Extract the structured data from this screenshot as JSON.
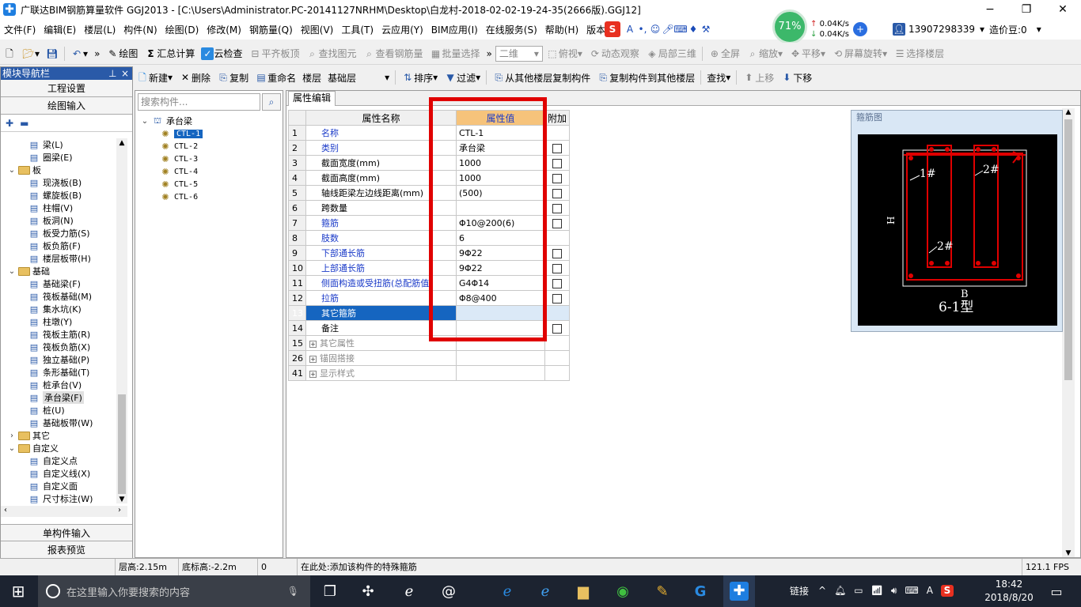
{
  "window": {
    "title": "广联达BIM钢筋算量软件 GGJ2013 - [C:\\Users\\Administrator.PC-20141127NRHM\\Desktop\\白龙村-2018-02-02-19-24-35(2666版).GGJ12]",
    "min": "−",
    "max": "❐",
    "close": "✕"
  },
  "menu": [
    "文件(F)",
    "编辑(E)",
    "楼层(L)",
    "构件(N)",
    "绘图(D)",
    "修改(M)",
    "钢筋量(Q)",
    "视图(V)",
    "工具(T)",
    "云应用(Y)",
    "BIM应用(I)",
    "在线服务(S)",
    "帮助(H)",
    "版本号"
  ],
  "net_widget": {
    "percent": "71%",
    "up": "0.04K/s",
    "down": "0.04K/s"
  },
  "user": {
    "phone": "13907298339",
    "beans": "造价豆:0"
  },
  "toolbar1": {
    "draw": "绘图",
    "sum": "汇总计算",
    "cloud_check": "云检查",
    "flat_top": "平齐板顶",
    "find_elem": "查找图元",
    "view_rebar": "查看钢筋量",
    "batch_select": "批量选择",
    "view_mode": "二维",
    "top_view": "俯视",
    "dynamic": "动态观察",
    "local3d": "局部三维",
    "fullscreen": "全屏",
    "zoom": "缩放",
    "pan": "平移",
    "rotate": "屏幕旋转",
    "select_floor": "选择楼层"
  },
  "nav": {
    "title": "模块导航栏",
    "project_settings": "工程设置",
    "drawing_input": "绘图输入",
    "single_input": "单构件输入",
    "report_preview": "报表预览",
    "tree": [
      {
        "label": "梁(L)",
        "level": 2,
        "icon": "beam-icon"
      },
      {
        "label": "圈梁(E)",
        "level": 2,
        "icon": "ring-beam-icon"
      },
      {
        "label": "板",
        "level": 1,
        "icon": "folder",
        "exp": "⌄"
      },
      {
        "label": "现浇板(B)",
        "level": 2,
        "icon": "slab-icon"
      },
      {
        "label": "螺旋板(B)",
        "level": 2,
        "icon": "spiral-slab-icon"
      },
      {
        "label": "柱帽(V)",
        "level": 2,
        "icon": "column-cap-icon"
      },
      {
        "label": "板洞(N)",
        "level": 2,
        "icon": "slab-hole-icon"
      },
      {
        "label": "板受力筋(S)",
        "level": 2,
        "icon": "slab-rebar-icon"
      },
      {
        "label": "板负筋(F)",
        "level": 2,
        "icon": "slab-neg-rebar-icon"
      },
      {
        "label": "楼层板带(H)",
        "level": 2,
        "icon": "slab-strip-icon"
      },
      {
        "label": "基础",
        "level": 1,
        "icon": "folder",
        "exp": "⌄"
      },
      {
        "label": "基础梁(F)",
        "level": 2,
        "icon": "foundation-beam-icon"
      },
      {
        "label": "筏板基础(M)",
        "level": 2,
        "icon": "raft-icon"
      },
      {
        "label": "集水坑(K)",
        "level": 2,
        "icon": "sump-icon"
      },
      {
        "label": "柱墩(Y)",
        "level": 2,
        "icon": "pier-icon"
      },
      {
        "label": "筏板主筋(R)",
        "level": 2,
        "icon": "raft-main-rebar-icon"
      },
      {
        "label": "筏板负筋(X)",
        "level": 2,
        "icon": "raft-neg-rebar-icon"
      },
      {
        "label": "独立基础(P)",
        "level": 2,
        "icon": "isolated-footing-icon"
      },
      {
        "label": "条形基础(T)",
        "level": 2,
        "icon": "strip-footing-icon"
      },
      {
        "label": "桩承台(V)",
        "level": 2,
        "icon": "pile-cap-icon"
      },
      {
        "label": "承台梁(F)",
        "level": 2,
        "icon": "cap-beam-icon",
        "selected": true
      },
      {
        "label": "桩(U)",
        "level": 2,
        "icon": "pile-icon"
      },
      {
        "label": "基础板带(W)",
        "level": 2,
        "icon": "foundation-strip-icon"
      },
      {
        "label": "其它",
        "level": 1,
        "icon": "folder",
        "exp": "›"
      },
      {
        "label": "自定义",
        "level": 1,
        "icon": "folder",
        "exp": "⌄"
      },
      {
        "label": "自定义点",
        "level": 2,
        "icon": "custom-point-icon"
      },
      {
        "label": "自定义线(X)",
        "level": 2,
        "icon": "custom-line-icon"
      },
      {
        "label": "自定义面",
        "level": 2,
        "icon": "custom-face-icon"
      },
      {
        "label": "尺寸标注(W)",
        "level": 2,
        "icon": "dimension-icon"
      }
    ]
  },
  "toolbar2": {
    "new": "新建",
    "delete": "删除",
    "copy": "复制",
    "rename": "重命名",
    "floor_label": "楼层",
    "floor_value": "基础层",
    "sort": "排序",
    "filter": "过滤",
    "copy_from": "从其他楼层复制构件",
    "copy_to": "复制构件到其他楼层",
    "find": "查找",
    "move_up": "上移",
    "move_down": "下移"
  },
  "components": {
    "search_placeholder": "搜索构件...",
    "root": "承台梁",
    "items": [
      "CTL-1",
      "CTL-2",
      "CTL-3",
      "CTL-4",
      "CTL-5",
      "CTL-6"
    ]
  },
  "props": {
    "tab": "属性编辑",
    "headers": {
      "name": "属性名称",
      "value": "属性值",
      "add": "附加"
    },
    "rows": [
      {
        "n": "1",
        "name": "名称",
        "value": "CTL-1",
        "blue": true,
        "cb": false
      },
      {
        "n": "2",
        "name": "类别",
        "value": "承台梁",
        "blue": true,
        "cb": true
      },
      {
        "n": "3",
        "name": "截面宽度(mm)",
        "value": "1000",
        "blue": false,
        "cb": true
      },
      {
        "n": "4",
        "name": "截面高度(mm)",
        "value": "1000",
        "blue": false,
        "cb": true
      },
      {
        "n": "5",
        "name": "轴线距梁左边线距离(mm)",
        "value": "(500)",
        "blue": false,
        "cb": true
      },
      {
        "n": "6",
        "name": "跨数量",
        "value": "",
        "blue": false,
        "cb": true
      },
      {
        "n": "7",
        "name": "箍筋",
        "value": "Φ10@200(6)",
        "blue": true,
        "cb": true
      },
      {
        "n": "8",
        "name": "肢数",
        "value": "6",
        "blue": true,
        "cb": false
      },
      {
        "n": "9",
        "name": "下部通长筋",
        "value": "9Φ22",
        "blue": true,
        "cb": true
      },
      {
        "n": "10",
        "name": "上部通长筋",
        "value": "9Φ22",
        "blue": true,
        "cb": true
      },
      {
        "n": "11",
        "name": "侧面构造或受扭筋(总配筋值)",
        "value": "G4Φ14",
        "blue": true,
        "cb": true
      },
      {
        "n": "12",
        "name": "拉筋",
        "value": "Φ8@400",
        "blue": true,
        "cb": true
      },
      {
        "n": "13",
        "name": "其它箍筋",
        "value": "",
        "blue": false,
        "cb": false,
        "selected": true
      },
      {
        "n": "14",
        "name": "备注",
        "value": "",
        "blue": false,
        "cb": true
      }
    ],
    "groups": [
      {
        "n": "15",
        "name": "其它属性"
      },
      {
        "n": "26",
        "name": "锚固搭接"
      },
      {
        "n": "41",
        "name": "显示样式"
      }
    ]
  },
  "stirrup": {
    "title": "箍筋图",
    "label1": "1#",
    "label2": "2#",
    "label3": "2#",
    "h": "H",
    "b": "B",
    "type": "6-1型"
  },
  "status": {
    "floor_height": "层高:2.15m",
    "bottom_height": "底标高:-2.2m",
    "zero": "0",
    "hint": "在此处:添加该构件的特殊箍筋",
    "fps": "121.1 FPS"
  },
  "taskbar": {
    "search": "在这里输入你要搜索的内容",
    "link": "链接",
    "time": "18:42",
    "date": "2018/8/20",
    "ime": "A"
  },
  "colors": {
    "highlight": "#e00000",
    "selected": "#1565c0",
    "nav_title": "#2a5aa8"
  }
}
